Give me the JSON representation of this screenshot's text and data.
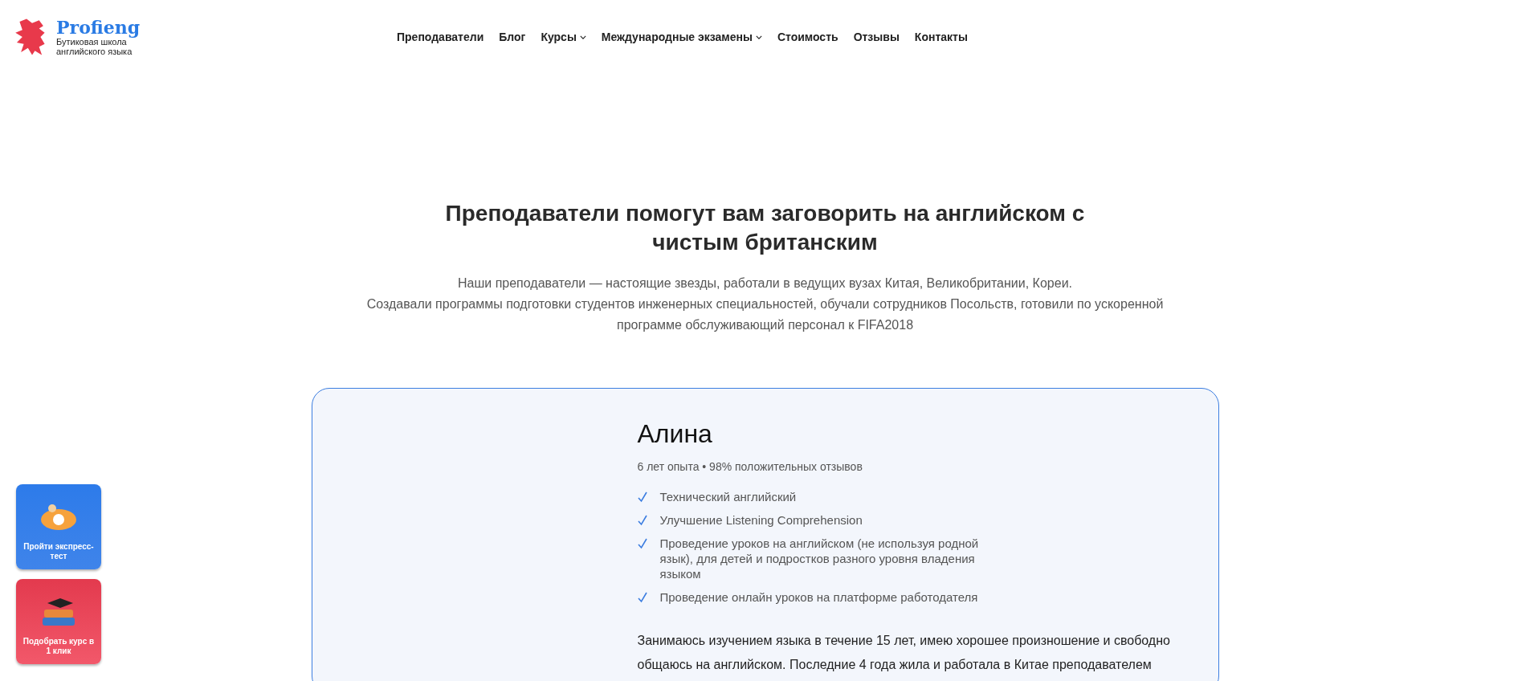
{
  "logo": {
    "name": "Profieng",
    "tagline": "Бутиковая школа английского языка"
  },
  "nav": [
    {
      "label": "Преподаватели",
      "has_dropdown": false
    },
    {
      "label": "Блог",
      "has_dropdown": false
    },
    {
      "label": "Курсы",
      "has_dropdown": true
    },
    {
      "label": "Международные экзамены",
      "has_dropdown": true
    },
    {
      "label": "Стоимость",
      "has_dropdown": false
    },
    {
      "label": "Отзывы",
      "has_dropdown": false
    },
    {
      "label": "Контакты",
      "has_dropdown": false
    }
  ],
  "section": {
    "title": "Преподаватели помогут вам заговорить на английском с чистым британским",
    "intro": [
      "Наши преподаватели — настоящие звезды, работали в ведущих вузах Китая, Великобритании, Кореи.",
      "Создавали программы подготовки студентов инженерных специальностей, обучали сотрудников Посольств, готовили по ускоренной программе обслуживающий персонал к FIFA2018"
    ]
  },
  "teacher": {
    "name": "Алина",
    "meta": "6 лет опыта • 98% положительных отзывов",
    "skills": [
      "Технический английский",
      "Улучшение Listening Comprehension",
      "Проведение уроков на английском (не используя родной язык), для детей и подростков разного уровня владения языком",
      "Проведение онлайн уроков на платформе работодателя"
    ],
    "bio": "Занимаюсь изучением языка в течение 15 лет, имею хорошее произношение и свободно общаюсь на английском. Последние 4 года жила и работала в Китае преподавателем"
  },
  "side_buttons": [
    {
      "kind": "test",
      "label": "Пройти экспресс-тест"
    },
    {
      "kind": "course",
      "label": "Подобрать курс в 1 клик"
    }
  ]
}
